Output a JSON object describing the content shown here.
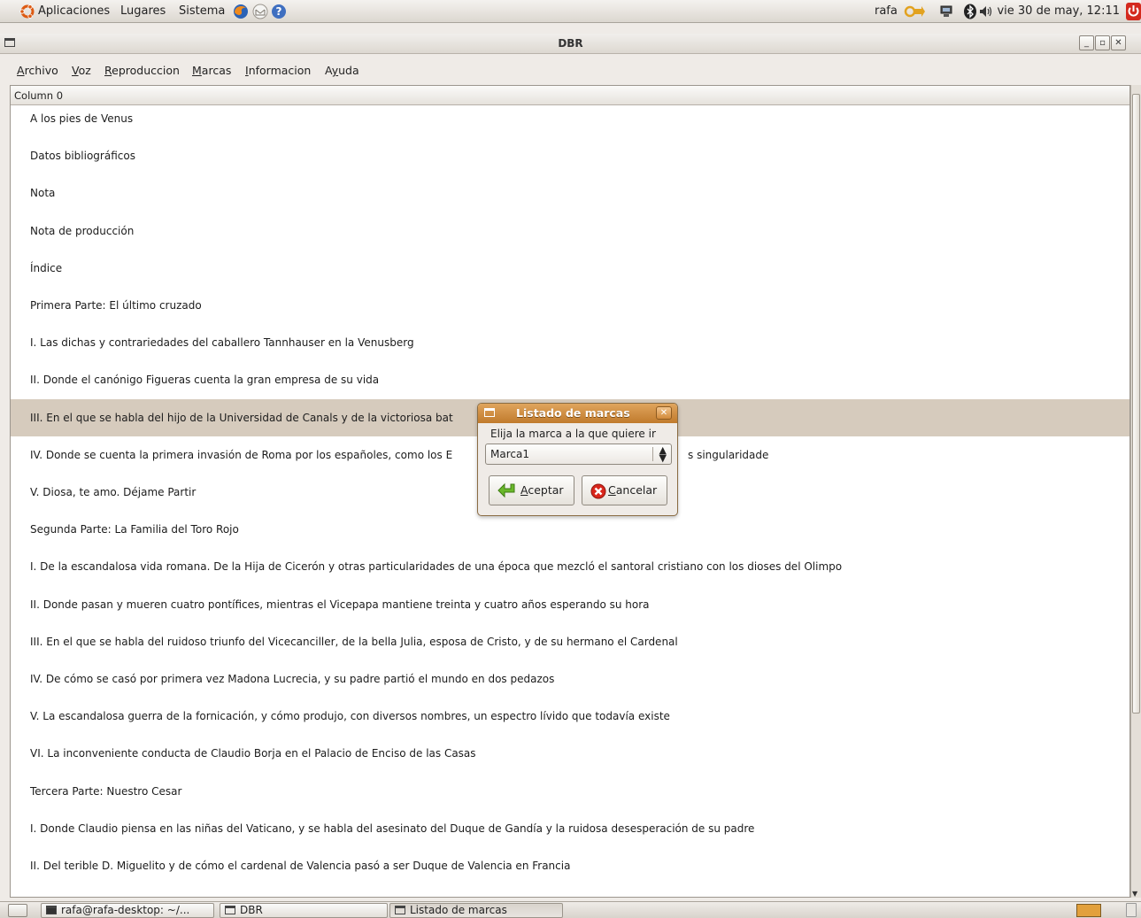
{
  "top_panel": {
    "menus": [
      "Aplicaciones",
      "Lugares",
      "Sistema"
    ],
    "user": "rafa",
    "clock": "vie 30 de may, 12:11"
  },
  "window": {
    "title": "DBR"
  },
  "menubar": {
    "items": [
      {
        "label": "Archivo",
        "mnemonic": "A"
      },
      {
        "label": "Voz",
        "mnemonic": "V"
      },
      {
        "label": "Reproduccion",
        "mnemonic": "R"
      },
      {
        "label": "Marcas",
        "mnemonic": "M"
      },
      {
        "label": "Informacion",
        "mnemonic": "I"
      },
      {
        "label": "Ayuda",
        "mnemonic": "y"
      }
    ]
  },
  "list": {
    "column_header": "Column 0",
    "selected_index": 8,
    "rows": [
      "A los pies de Venus",
      "Datos bibliográficos",
      "Nota",
      "Nota de producción",
      "Índice",
      "Primera Parte: El último cruzado",
      "I. Las dichas y contrariedades del caballero Tannhauser en la Venusberg",
      "II. Donde el canónigo Figueras cuenta la gran empresa de su vida",
      "III. En el que se habla del hijo de la Universidad de Canals y de la victoriosa bat",
      "IV. Donde se cuenta la primera invasión de Roma por los españoles, como los E",
      "V. Diosa, te amo. Déjame Partir",
      "Segunda Parte: La Familia del Toro Rojo",
      "I. De la escandalosa vida romana. De la Hija de Cicerón y otras particularidades de una época que mezcló el santoral cristiano con los dioses del Olimpo",
      "II. Donde pasan y mueren cuatro pontífices, mientras el Vicepapa mantiene treinta y cuatro años esperando su hora",
      "III. En el que se habla del ruidoso triunfo del Vicecanciller, de la bella Julia, esposa de Cristo, y de su hermano el Cardenal",
      "IV. De cómo se casó por primera vez Madona Lucrecia, y su padre partió el mundo en dos pedazos",
      "V. La escandalosa guerra de la fornicación, y cómo produjo, con diversos nombres, un espectro lívido que todavía existe",
      "VI. La inconveniente conducta de Claudio Borja en el Palacio de Enciso de las Casas",
      "Tercera Parte: Nuestro Cesar",
      "I. Donde Claudio piensa en las niñas del Vaticano, y se habla del asesinato del Duque de Gandía y la ruidosa desesperación de su padre",
      "II. Del terible D. Miguelito y de cómo el cardenal de Valencia pasó a ser Duque de Valencia en Francia"
    ],
    "row_10_tail": "s singularidade"
  },
  "dialog": {
    "title": "Listado de marcas",
    "prompt": "Elija la marca a la que quiere ir",
    "selected_mark": "Marca1",
    "accept_label": "Aceptar",
    "accept_mnemonic": "A",
    "cancel_label": "Cancelar",
    "cancel_mnemonic": "C"
  },
  "taskbar": {
    "tasks": [
      {
        "label": "rafa@rafa-desktop: ~/...",
        "active": false
      },
      {
        "label": "DBR",
        "active": false
      },
      {
        "label": "Listado de marcas",
        "active": true
      }
    ]
  },
  "colors": {
    "selection": "#d6cbbd",
    "dialog_title": "#c98a3d"
  }
}
